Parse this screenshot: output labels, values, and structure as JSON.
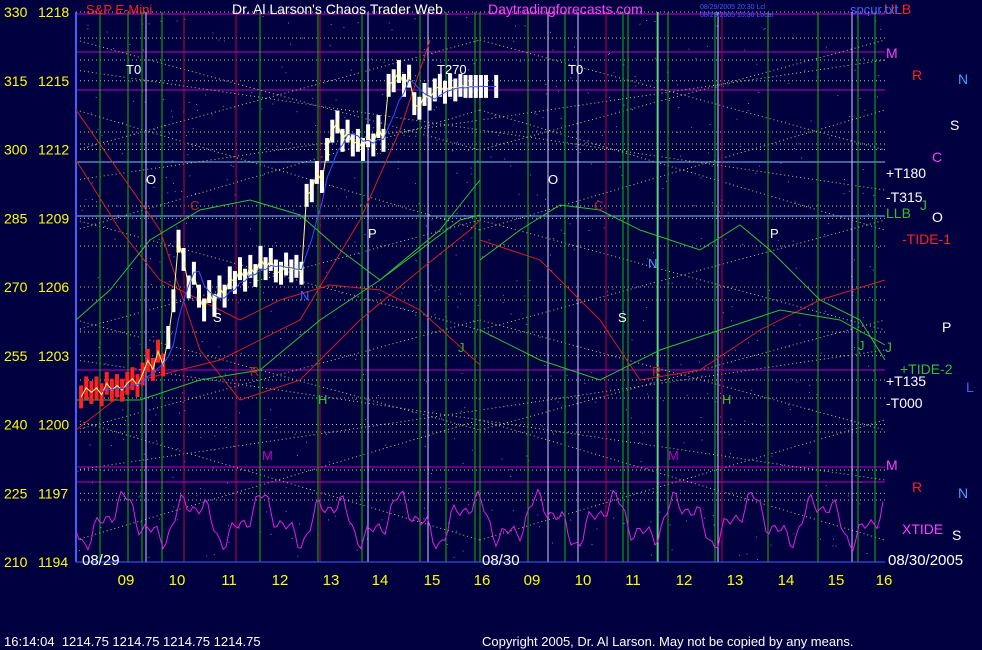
{
  "header": {
    "instrument": "S&P E-Mini",
    "site_title": "Dr. Al Larson's Chaos Trader Web",
    "site_url": "Daytradingforecasts.com",
    "timestamp_1": "08/29/2005 20:30 Lcl",
    "timestamp_2": "08/29/2005 15:30 Local",
    "corner_label": "spcur.txt"
  },
  "footer": {
    "quote": "16:14:04  1214.75 1214.75 1214.75 1214.75",
    "copyright": "Copyright 2005, Dr. Al Larson. May not be copied by any means."
  },
  "colors": {
    "background": "#000040",
    "grid_green": "#00c000",
    "grid_magenta": "#c000c0",
    "grid_yellow": "#c8c880",
    "price_white": "#ffffff",
    "price_red": "#ff2020",
    "axis_yellow": "#ffff00",
    "label_cyan": "#40a0ff"
  },
  "chart_data": {
    "type": "line",
    "title": "S&P E-Mini",
    "xlabel": "",
    "ylabel": "",
    "ylim": [
      1194,
      1218
    ],
    "y_ticks": [
      {
        "angle": "330",
        "price": "1218",
        "value": 1218
      },
      {
        "angle": "315",
        "price": "1215",
        "value": 1215
      },
      {
        "angle": "300",
        "price": "1212",
        "value": 1212
      },
      {
        "angle": "285",
        "price": "1209",
        "value": 1209
      },
      {
        "angle": "270",
        "price": "1206",
        "value": 1206
      },
      {
        "angle": "255",
        "price": "1203",
        "value": 1203
      },
      {
        "angle": "240",
        "price": "1200",
        "value": 1200
      },
      {
        "angle": "225",
        "price": "1197",
        "value": 1197
      },
      {
        "angle": "210",
        "price": "1194",
        "value": 1194
      }
    ],
    "x_ticks": [
      "09",
      "10",
      "11",
      "12",
      "13",
      "14",
      "15",
      "16",
      "09",
      "10",
      "11",
      "12",
      "13",
      "14",
      "15",
      "16"
    ],
    "date_labels": [
      "08/29",
      "08/30",
      "08/30/2005"
    ],
    "series": [
      {
        "name": "S&P E-Mini",
        "x": [
          8.1,
          8.2,
          8.3,
          8.4,
          8.5,
          8.6,
          8.7,
          8.8,
          8.9,
          9.0,
          9.1,
          9.2,
          9.3,
          9.4,
          9.5,
          9.6,
          9.7,
          9.8,
          9.9,
          10.0,
          10.1,
          10.2,
          10.3,
          10.4,
          10.5,
          10.6,
          10.7,
          10.8,
          10.9,
          11.0,
          11.1,
          11.2,
          11.3,
          11.4,
          11.5,
          11.6,
          11.7,
          11.8,
          11.9,
          12.0,
          12.1,
          12.2,
          12.3,
          12.4,
          12.5,
          12.6,
          12.7,
          12.8,
          12.9,
          13.0,
          13.1,
          13.2,
          13.3,
          13.4,
          13.5,
          13.6,
          13.7,
          13.8,
          13.9,
          14.0,
          14.1,
          14.2,
          14.3,
          14.4,
          14.5,
          14.6,
          14.7,
          14.8,
          14.9,
          15.0,
          15.1,
          15.2,
          15.3,
          15.4,
          15.5,
          15.6,
          15.7,
          15.8,
          15.9,
          16.0,
          16.2
        ],
        "values": [
          1201.2,
          1201.6,
          1201.4,
          1201.6,
          1201.3,
          1201.8,
          1201.5,
          1201.7,
          1201.5,
          1201.8,
          1202.0,
          1201.7,
          1202.2,
          1202.8,
          1202.4,
          1203.2,
          1202.6,
          1203.8,
          1205.4,
          1208.0,
          1207.2,
          1206.0,
          1206.6,
          1205.6,
          1205.0,
          1205.8,
          1205.2,
          1206.0,
          1205.6,
          1206.4,
          1206.2,
          1206.8,
          1206.3,
          1206.9,
          1206.5,
          1207.3,
          1206.8,
          1207.2,
          1206.7,
          1206.6,
          1207.0,
          1206.7,
          1206.9,
          1206.6,
          1210.0,
          1210.2,
          1211.0,
          1210.6,
          1212.0,
          1212.8,
          1213.2,
          1212.4,
          1212.8,
          1212.2,
          1212.4,
          1212.0,
          1212.6,
          1212.2,
          1213.0,
          1212.4,
          1214.8,
          1215.0,
          1215.4,
          1214.8,
          1215.2,
          1214.0,
          1213.8,
          1214.4,
          1214.2,
          1214.6,
          1214.8,
          1214.5,
          1214.8,
          1214.6,
          1214.8,
          1214.75,
          1214.75,
          1214.75,
          1214.75,
          1214.75,
          1214.75
        ]
      }
    ],
    "curve_labels": [
      "O",
      "P",
      "S",
      "R",
      "H",
      "J",
      "C",
      "M",
      "N",
      "O",
      "P",
      "S",
      "R",
      "H",
      "J",
      "C",
      "M",
      "N"
    ],
    "time_markers": [
      "T0",
      "T270",
      "T0"
    ],
    "right_labels": [
      "ULB",
      "M",
      "R",
      "N",
      "S",
      "C",
      "+T180",
      "-T315",
      "LLB",
      "J",
      "O",
      "-TIDE-1",
      "P",
      "J",
      "+TIDE-2",
      "L",
      "+T135",
      "-T000",
      "M",
      "R",
      "N",
      "XTIDE",
      "S"
    ],
    "legend": "none",
    "grid": true
  }
}
